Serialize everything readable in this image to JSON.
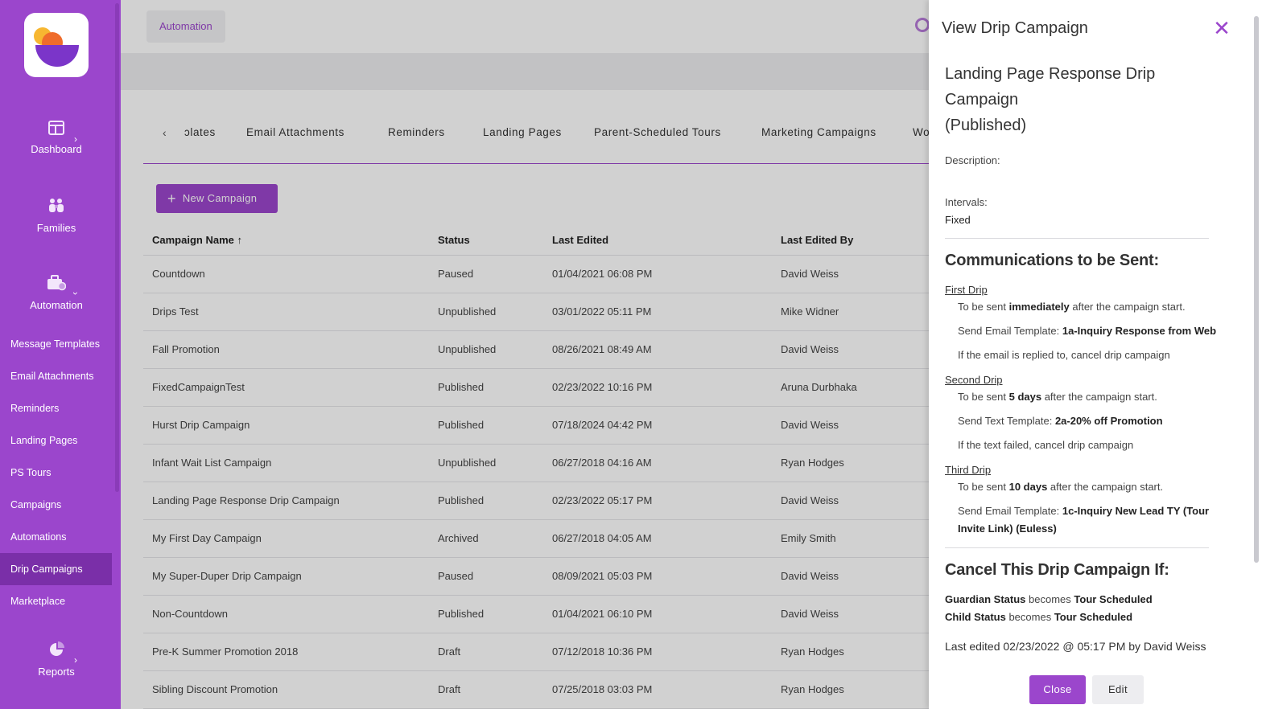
{
  "sidebar": {
    "main": [
      {
        "label": "Dashboard",
        "icon": "dashboard-icon"
      },
      {
        "label": "Families",
        "icon": "families-icon"
      },
      {
        "label": "Automation",
        "icon": "automation-icon"
      },
      {
        "label": "Reports",
        "icon": "reports-icon"
      }
    ],
    "sub": [
      "Message Templates",
      "Email Attachments",
      "Reminders",
      "Landing Pages",
      "PS Tours",
      "Campaigns",
      "Automations",
      "Drip Campaigns",
      "Marketplace"
    ],
    "active": "Drip Campaigns",
    "accent": "#9b46cc"
  },
  "header": {
    "breadcrumb": "Automation"
  },
  "tabs": {
    "items": [
      "ɔlates",
      "Email Attachments",
      "Reminders",
      "Landing Pages",
      "Parent-Scheduled Tours",
      "Marketing Campaigns",
      "Wo"
    ]
  },
  "toolbar": {
    "new_label": "New Campaign"
  },
  "table": {
    "headers": [
      "Campaign Name",
      "Status",
      "Last Edited",
      "Last Edited By"
    ],
    "sort_indicator": "↑",
    "rows": [
      [
        "Countdown",
        "Paused",
        "01/04/2021 06:08 PM",
        "David Weiss"
      ],
      [
        "Drips Test",
        "Unpublished",
        "03/01/2022 05:11 PM",
        "Mike Widner"
      ],
      [
        "Fall Promotion",
        "Unpublished",
        "08/26/2021 08:49 AM",
        "David Weiss"
      ],
      [
        "FixedCampaignTest",
        "Published",
        "02/23/2022 10:16 PM",
        "Aruna Durbhaka"
      ],
      [
        "Hurst Drip Campaign",
        "Published",
        "07/18/2024 04:42 PM",
        "David Weiss"
      ],
      [
        "Infant Wait List Campaign",
        "Unpublished",
        "06/27/2018 04:16 AM",
        "Ryan Hodges"
      ],
      [
        "Landing Page Response Drip Campaign",
        "Published",
        "02/23/2022 05:17 PM",
        "David Weiss"
      ],
      [
        "My First Day Campaign",
        "Archived",
        "06/27/2018 04:05 AM",
        "Emily Smith"
      ],
      [
        "My Super-Duper Drip Campaign",
        "Paused",
        "08/09/2021 05:03 PM",
        "David Weiss"
      ],
      [
        "Non-Countdown",
        "Published",
        "01/04/2021 06:10 PM",
        "David Weiss"
      ],
      [
        "Pre-K Summer Promotion 2018",
        "Draft",
        "07/12/2018 10:36 PM",
        "Ryan Hodges"
      ],
      [
        "Sibling Discount Promotion",
        "Draft",
        "07/25/2018 03:03 PM",
        "Ryan Hodges"
      ]
    ]
  },
  "drawer": {
    "title": "View Drip Campaign",
    "campaign_name": "Landing Page Response Drip Campaign",
    "campaign_state": "(Published)",
    "description_label": "Description:",
    "intervals_label": "Intervals:",
    "intervals_value": "Fixed",
    "comms_heading": "Communications to be Sent:",
    "drips": [
      {
        "title": "First Drip",
        "timing_pre": "To be sent ",
        "timing_bold": "immediately",
        "timing_post": " after the campaign start.",
        "template_pre": "Send Email Template: ",
        "template_bold": "1a-Inquiry Response from Web",
        "cancel": "If the email is replied to, cancel drip campaign"
      },
      {
        "title": "Second Drip",
        "timing_pre": "To be sent ",
        "timing_bold": "5 days",
        "timing_post": " after the campaign start.",
        "template_pre": "Send Text Template: ",
        "template_bold": "2a-20% off Promotion",
        "cancel": "If the text failed, cancel drip campaign"
      },
      {
        "title": "Third Drip",
        "timing_pre": "To be sent ",
        "timing_bold": "10 days",
        "timing_post": " after the campaign start.",
        "template_pre": "Send Email Template: ",
        "template_bold": "1c-Inquiry New Lead TY (Tour Invite Link) (Euless)"
      }
    ],
    "cancel_heading": "Cancel This Drip Campaign If:",
    "conditions": [
      {
        "field": "Guardian Status",
        "verb": " becomes ",
        "value": "Tour Scheduled"
      },
      {
        "field": "Child Status",
        "verb": " becomes ",
        "value": "Tour Scheduled"
      }
    ],
    "last_edited": "Last edited 02/23/2022 @ 05:17 PM by David Weiss",
    "close_label": "Close",
    "edit_label": "Edit",
    "close_icon": "close-icon"
  }
}
